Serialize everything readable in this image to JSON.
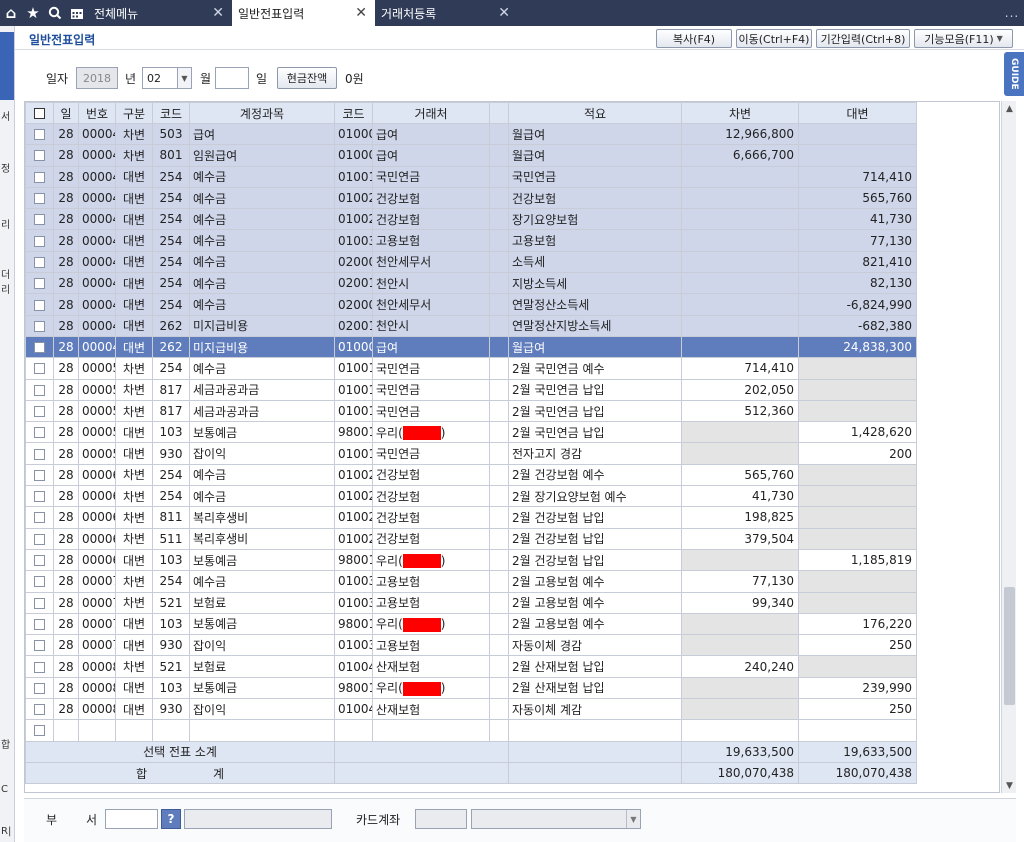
{
  "tabs": {
    "menu": "전체메뉴",
    "voucher": "일반전표입력",
    "partner": "거래처등록",
    "more": "..."
  },
  "left_strip": [
    "서",
    "정",
    "리",
    "더리",
    "합",
    "C",
    "R|"
  ],
  "page": {
    "title": "일반전표입력",
    "buttons": {
      "copy": "복사(F4)",
      "move": "이동(Ctrl+F4)",
      "period": "기간입력(Ctrl+8)",
      "functions": "기능모음(F11)",
      "functions_arrow": "▼"
    },
    "guide": "GUIDE"
  },
  "filter": {
    "date_label": "일자",
    "year": "2018",
    "year_label": "년",
    "month": "02",
    "month_label": "월",
    "day": "",
    "day_label": "일",
    "cash_button": "현금잔액",
    "cash_value": "0원"
  },
  "grid": {
    "headers": [
      "",
      "일",
      "번호",
      "구분",
      "코드",
      "계정과목",
      "코드",
      "거래처",
      "",
      "적요",
      "차변",
      "대변"
    ],
    "rows": [
      {
        "state": "posted",
        "day": "28",
        "no": "00004",
        "type": "차변",
        "acode": "503",
        "account": "급여",
        "pcode": "01000",
        "partner": "급여",
        "redact": false,
        "memo": "월급여",
        "debit": "12,966,800",
        "credit": "",
        "dg": false,
        "cg": false
      },
      {
        "state": "posted",
        "day": "28",
        "no": "00004",
        "type": "차변",
        "acode": "801",
        "account": "임원급여",
        "pcode": "01000",
        "partner": "급여",
        "redact": false,
        "memo": "월급여",
        "debit": "6,666,700",
        "credit": "",
        "dg": false,
        "cg": false
      },
      {
        "state": "posted",
        "day": "28",
        "no": "00004",
        "type": "대변",
        "acode": "254",
        "account": "예수금",
        "pcode": "01001",
        "partner": "국민연금",
        "redact": false,
        "memo": "국민연금",
        "debit": "",
        "credit": "714,410",
        "dg": false,
        "cg": false
      },
      {
        "state": "posted",
        "day": "28",
        "no": "00004",
        "type": "대변",
        "acode": "254",
        "account": "예수금",
        "pcode": "01002",
        "partner": "건강보험",
        "redact": false,
        "memo": "건강보험",
        "debit": "",
        "credit": "565,760",
        "dg": false,
        "cg": false
      },
      {
        "state": "posted",
        "day": "28",
        "no": "00004",
        "type": "대변",
        "acode": "254",
        "account": "예수금",
        "pcode": "01002",
        "partner": "건강보험",
        "redact": false,
        "memo": "장기요양보험",
        "debit": "",
        "credit": "41,730",
        "dg": false,
        "cg": false
      },
      {
        "state": "posted",
        "day": "28",
        "no": "00004",
        "type": "대변",
        "acode": "254",
        "account": "예수금",
        "pcode": "01003",
        "partner": "고용보험",
        "redact": false,
        "memo": "고용보험",
        "debit": "",
        "credit": "77,130",
        "dg": false,
        "cg": false
      },
      {
        "state": "posted",
        "day": "28",
        "no": "00004",
        "type": "대변",
        "acode": "254",
        "account": "예수금",
        "pcode": "02000",
        "partner": "천안세무서",
        "redact": false,
        "memo": "소득세",
        "debit": "",
        "credit": "821,410",
        "dg": false,
        "cg": false
      },
      {
        "state": "posted",
        "day": "28",
        "no": "00004",
        "type": "대변",
        "acode": "254",
        "account": "예수금",
        "pcode": "02001",
        "partner": "천안시",
        "redact": false,
        "memo": "지방소득세",
        "debit": "",
        "credit": "82,130",
        "dg": false,
        "cg": false
      },
      {
        "state": "posted",
        "day": "28",
        "no": "00004",
        "type": "대변",
        "acode": "254",
        "account": "예수금",
        "pcode": "02000",
        "partner": "천안세무서",
        "redact": false,
        "memo": "연말정산소득세",
        "debit": "",
        "credit": "-6,824,990",
        "dg": false,
        "cg": false
      },
      {
        "state": "posted",
        "day": "28",
        "no": "00004",
        "type": "대변",
        "acode": "262",
        "account": "미지급비용",
        "pcode": "02001",
        "partner": "천안시",
        "redact": false,
        "memo": "연말정산지방소득세",
        "debit": "",
        "credit": "-682,380",
        "dg": false,
        "cg": false
      },
      {
        "state": "selected",
        "day": "28",
        "no": "00004",
        "type": "대변",
        "acode": "262",
        "account": "미지급비용",
        "pcode": "01000",
        "partner": "급여",
        "redact": false,
        "memo": "월급여",
        "debit": "",
        "credit": "24,838,300",
        "dg": false,
        "cg": false
      },
      {
        "state": "normal",
        "day": "28",
        "no": "00005",
        "type": "차변",
        "acode": "254",
        "account": "예수금",
        "pcode": "01001",
        "partner": "국민연금",
        "redact": false,
        "memo": "2월 국민연금 예수",
        "debit": "714,410",
        "credit": "",
        "dg": false,
        "cg": true
      },
      {
        "state": "normal",
        "day": "28",
        "no": "00005",
        "type": "차변",
        "acode": "817",
        "account": "세금과공과금",
        "pcode": "01001",
        "partner": "국민연금",
        "redact": false,
        "memo": "2월 국민연금 납입",
        "debit": "202,050",
        "credit": "",
        "dg": false,
        "cg": true
      },
      {
        "state": "normal",
        "day": "28",
        "no": "00005",
        "type": "차변",
        "acode": "817",
        "account": "세금과공과금",
        "pcode": "01001",
        "partner": "국민연금",
        "redact": false,
        "memo": "2월 국민연금 납입",
        "debit": "512,360",
        "credit": "",
        "dg": false,
        "cg": true
      },
      {
        "state": "normal",
        "day": "28",
        "no": "00005",
        "type": "대변",
        "acode": "103",
        "account": "보통예금",
        "pcode": "98001",
        "partner": "우리(",
        "redact": true,
        "memo": "2월 국민연금 납입",
        "debit": "",
        "credit": "1,428,620",
        "dg": true,
        "cg": false
      },
      {
        "state": "normal",
        "day": "28",
        "no": "00005",
        "type": "대변",
        "acode": "930",
        "account": "잡이익",
        "pcode": "01001",
        "partner": "국민연금",
        "redact": false,
        "memo": "전자고지 경감",
        "debit": "",
        "credit": "200",
        "dg": true,
        "cg": false
      },
      {
        "state": "normal",
        "day": "28",
        "no": "00006",
        "type": "차변",
        "acode": "254",
        "account": "예수금",
        "pcode": "01002",
        "partner": "건강보험",
        "redact": false,
        "memo": "2월 건강보험 예수",
        "debit": "565,760",
        "credit": "",
        "dg": false,
        "cg": true
      },
      {
        "state": "normal",
        "day": "28",
        "no": "00006",
        "type": "차변",
        "acode": "254",
        "account": "예수금",
        "pcode": "01002",
        "partner": "건강보험",
        "redact": false,
        "memo": "2월 장기요양보험 예수",
        "debit": "41,730",
        "credit": "",
        "dg": false,
        "cg": true
      },
      {
        "state": "normal",
        "day": "28",
        "no": "00006",
        "type": "차변",
        "acode": "811",
        "account": "복리후생비",
        "pcode": "01002",
        "partner": "건강보험",
        "redact": false,
        "memo": "2월 건강보험 납입",
        "debit": "198,825",
        "credit": "",
        "dg": false,
        "cg": true
      },
      {
        "state": "normal",
        "day": "28",
        "no": "00006",
        "type": "차변",
        "acode": "511",
        "account": "복리후생비",
        "pcode": "01002",
        "partner": "건강보험",
        "redact": false,
        "memo": "2월 건강보험 납입",
        "debit": "379,504",
        "credit": "",
        "dg": false,
        "cg": true
      },
      {
        "state": "normal",
        "day": "28",
        "no": "00006",
        "type": "대변",
        "acode": "103",
        "account": "보통예금",
        "pcode": "98001",
        "partner": "우리(",
        "redact": true,
        "memo": "2월 건강보험 납입",
        "debit": "",
        "credit": "1,185,819",
        "dg": true,
        "cg": false
      },
      {
        "state": "normal",
        "day": "28",
        "no": "00007",
        "type": "차변",
        "acode": "254",
        "account": "예수금",
        "pcode": "01003",
        "partner": "고용보험",
        "redact": false,
        "memo": "2월 고용보험 예수",
        "debit": "77,130",
        "credit": "",
        "dg": false,
        "cg": true
      },
      {
        "state": "normal",
        "day": "28",
        "no": "00007",
        "type": "차변",
        "acode": "521",
        "account": "보험료",
        "pcode": "01003",
        "partner": "고용보험",
        "redact": false,
        "memo": "2월 고용보험 예수",
        "debit": "99,340",
        "credit": "",
        "dg": false,
        "cg": true
      },
      {
        "state": "normal",
        "day": "28",
        "no": "00007",
        "type": "대변",
        "acode": "103",
        "account": "보통예금",
        "pcode": "98001",
        "partner": "우리(",
        "redact": true,
        "memo": "2월 고용보험 예수",
        "debit": "",
        "credit": "176,220",
        "dg": true,
        "cg": false
      },
      {
        "state": "normal",
        "day": "28",
        "no": "00007",
        "type": "대변",
        "acode": "930",
        "account": "잡이익",
        "pcode": "01003",
        "partner": "고용보험",
        "redact": false,
        "memo": "자동이체 경감",
        "debit": "",
        "credit": "250",
        "dg": true,
        "cg": false
      },
      {
        "state": "normal",
        "day": "28",
        "no": "00008",
        "type": "차변",
        "acode": "521",
        "account": "보험료",
        "pcode": "01004",
        "partner": "산재보험",
        "redact": false,
        "memo": "2월 산재보험 납입",
        "debit": "240,240",
        "credit": "",
        "dg": false,
        "cg": true
      },
      {
        "state": "normal",
        "day": "28",
        "no": "00008",
        "type": "대변",
        "acode": "103",
        "account": "보통예금",
        "pcode": "98001",
        "partner": "우리(",
        "redact": true,
        "memo": "2월 산재보험 납입",
        "debit": "",
        "credit": "239,990",
        "dg": true,
        "cg": false
      },
      {
        "state": "normal",
        "day": "28",
        "no": "00008",
        "type": "대변",
        "acode": "930",
        "account": "잡이익",
        "pcode": "01004",
        "partner": "산재보험",
        "redact": false,
        "memo": "자동이체 계감",
        "debit": "",
        "credit": "250",
        "dg": true,
        "cg": false
      }
    ],
    "subtotal_label": "선택 전표 소계",
    "subtotal_debit": "19,633,500",
    "subtotal_credit": "19,633,500",
    "total_label_1": "합",
    "total_label_2": "계",
    "total_debit": "180,070,438",
    "total_credit": "180,070,438"
  },
  "bottom": {
    "dept_label_1": "부",
    "dept_label_2": "서",
    "help": "?",
    "card_label": "카드계좌"
  },
  "colors": {
    "posted_row": "#cfd6ea",
    "selected_row": "#5f7cbc",
    "header": "#dfe6f3",
    "tabbar": "#2f3b57",
    "redaction": "#ff0000"
  }
}
